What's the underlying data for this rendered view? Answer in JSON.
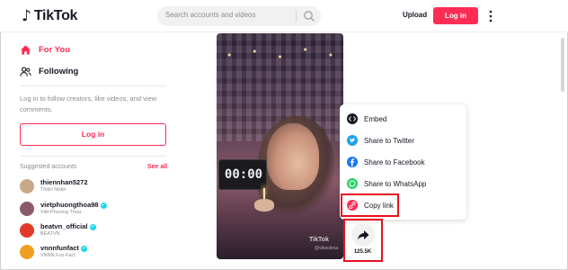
{
  "app": {
    "logo_text": "TikTok"
  },
  "header": {
    "search_placeholder": "Search accounts and videos",
    "upload_label": "Upload",
    "login_label": "Log in"
  },
  "sidebar": {
    "nav": [
      {
        "label": "For You",
        "icon": "home-icon",
        "active": true
      },
      {
        "label": "Following",
        "icon": "people-icon",
        "active": false
      }
    ],
    "login_prompt": "Log in to follow creators, like videos, and view comments.",
    "login_button": "Log in",
    "suggested_title": "Suggested accounts",
    "see_all": "See all",
    "accounts": [
      {
        "username": "thiennhan5272",
        "display": "Thiện Nhân",
        "verified": false,
        "avatar_color": "#c9a88a"
      },
      {
        "username": "vietphuongthoa98",
        "display": "Việt Phương Thoa",
        "verified": true,
        "avatar_color": "#8a5a6a"
      },
      {
        "username": "beatvn_official",
        "display": "BEATVN",
        "verified": true,
        "avatar_color": "#e23a2a"
      },
      {
        "username": "vnnnfunfact",
        "display": "VNNN Fun Fact",
        "verified": true,
        "avatar_color": "#f0a020"
      }
    ]
  },
  "video": {
    "clock_text": "00:00",
    "watermark": "TikTok",
    "watermark_handle": "@vikaolena"
  },
  "share_menu": {
    "items": [
      {
        "label": "Embed",
        "icon": "embed-icon",
        "color": "#161823"
      },
      {
        "label": "Share to Twitter",
        "icon": "twitter-icon",
        "color": "#1da1f2"
      },
      {
        "label": "Share to Facebook",
        "icon": "facebook-icon",
        "color": "#1877f2"
      },
      {
        "label": "Share to WhatsApp",
        "icon": "whatsapp-icon",
        "color": "#25d366"
      },
      {
        "label": "Copy link",
        "icon": "link-icon",
        "color": "#fe2c55"
      }
    ]
  },
  "share_button": {
    "count": "125.5K"
  },
  "colors": {
    "brand": "#fe2c55",
    "highlight": "#e8101f",
    "verified": "#20d5ec"
  }
}
